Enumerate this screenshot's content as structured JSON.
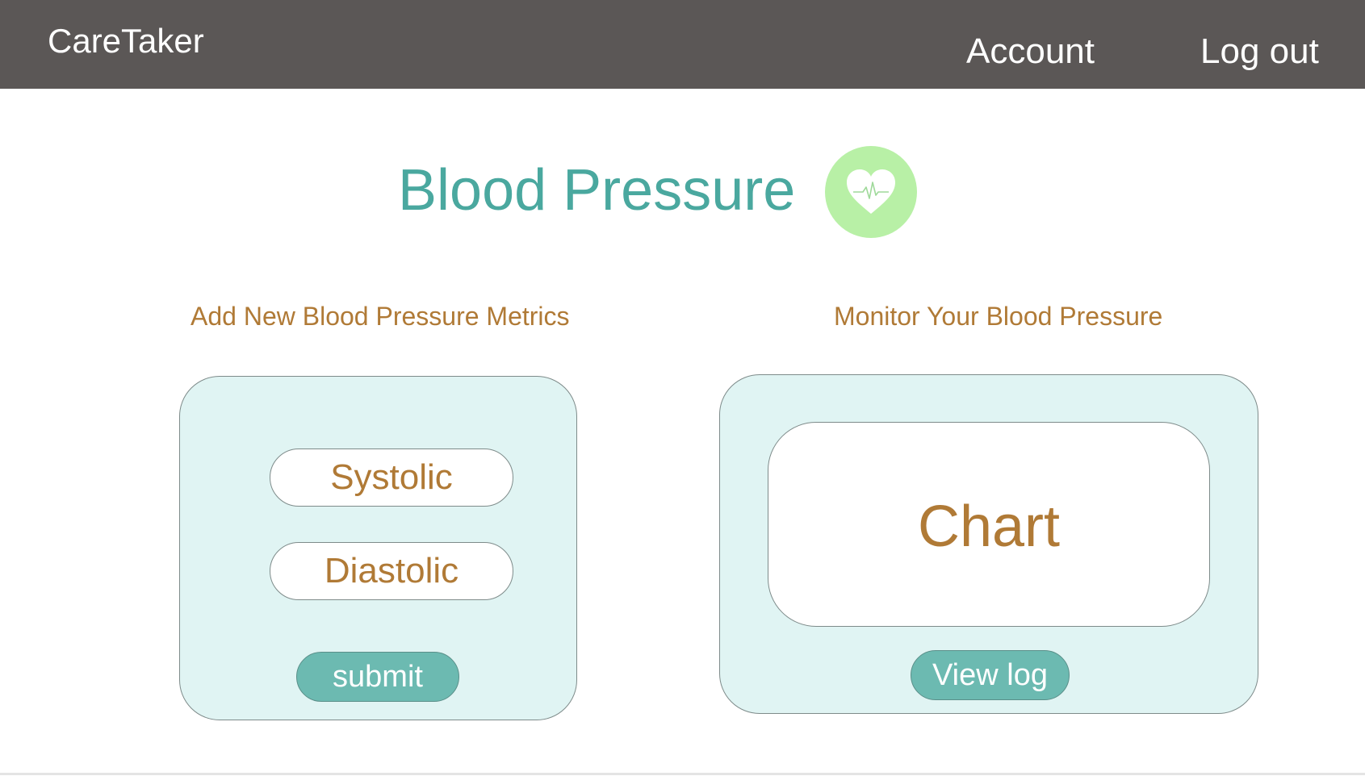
{
  "header": {
    "brand": "CareTaker",
    "nav": {
      "account": "Account",
      "logout": "Log out"
    }
  },
  "page": {
    "title": "Blood Pressure",
    "title_icon": "heart-pulse-icon"
  },
  "add_section": {
    "title": "Add New Blood Pressure Metrics",
    "systolic_placeholder": "Systolic",
    "diastolic_placeholder": "Diastolic",
    "submit_label": "submit"
  },
  "monitor_section": {
    "title": "Monitor Your Blood Pressure",
    "chart_label": "Chart",
    "view_log_label": "View log"
  },
  "colors": {
    "topbar": "#5b5756",
    "title_teal": "#4aa89f",
    "accent_brown": "#b07a36",
    "panel_bg": "#e0f4f3",
    "button_teal": "#6cbab1",
    "badge_green": "#b8f0a6"
  }
}
